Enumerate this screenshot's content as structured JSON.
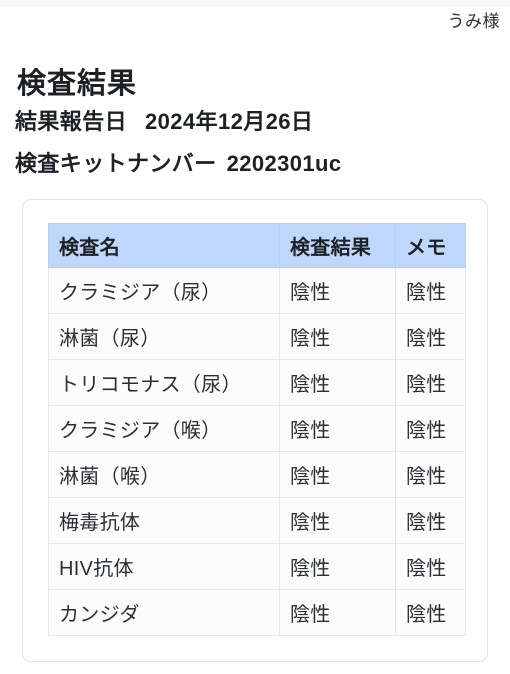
{
  "user": {
    "name": "うみ様"
  },
  "page": {
    "title": "検査結果"
  },
  "meta": {
    "report_date_label": "結果報告日",
    "report_date_value": "2024年12月26日",
    "kit_number_label": "検査キットナンバー",
    "kit_number_value": "2202301uc"
  },
  "table": {
    "columns": [
      "検査名",
      "検査結果",
      "メモ"
    ],
    "rows": [
      [
        "クラミジア（尿）",
        "陰性",
        "陰性"
      ],
      [
        "淋菌（尿）",
        "陰性",
        "陰性"
      ],
      [
        "トリコモナス（尿）",
        "陰性",
        "陰性"
      ],
      [
        "クラミジア（喉）",
        "陰性",
        "陰性"
      ],
      [
        "淋菌（喉）",
        "陰性",
        "陰性"
      ],
      [
        "梅毒抗体",
        "陰性",
        "陰性"
      ],
      [
        "HIV抗体",
        "陰性",
        "陰性"
      ],
      [
        "カンジダ",
        "陰性",
        "陰性"
      ]
    ]
  },
  "colors": {
    "header_blue": "#bfd7fb",
    "card_border": "#e3e4e6",
    "cell_border": "#e6e7e9",
    "text": "#2b2f34",
    "top_strip": "#f7f7f8"
  }
}
